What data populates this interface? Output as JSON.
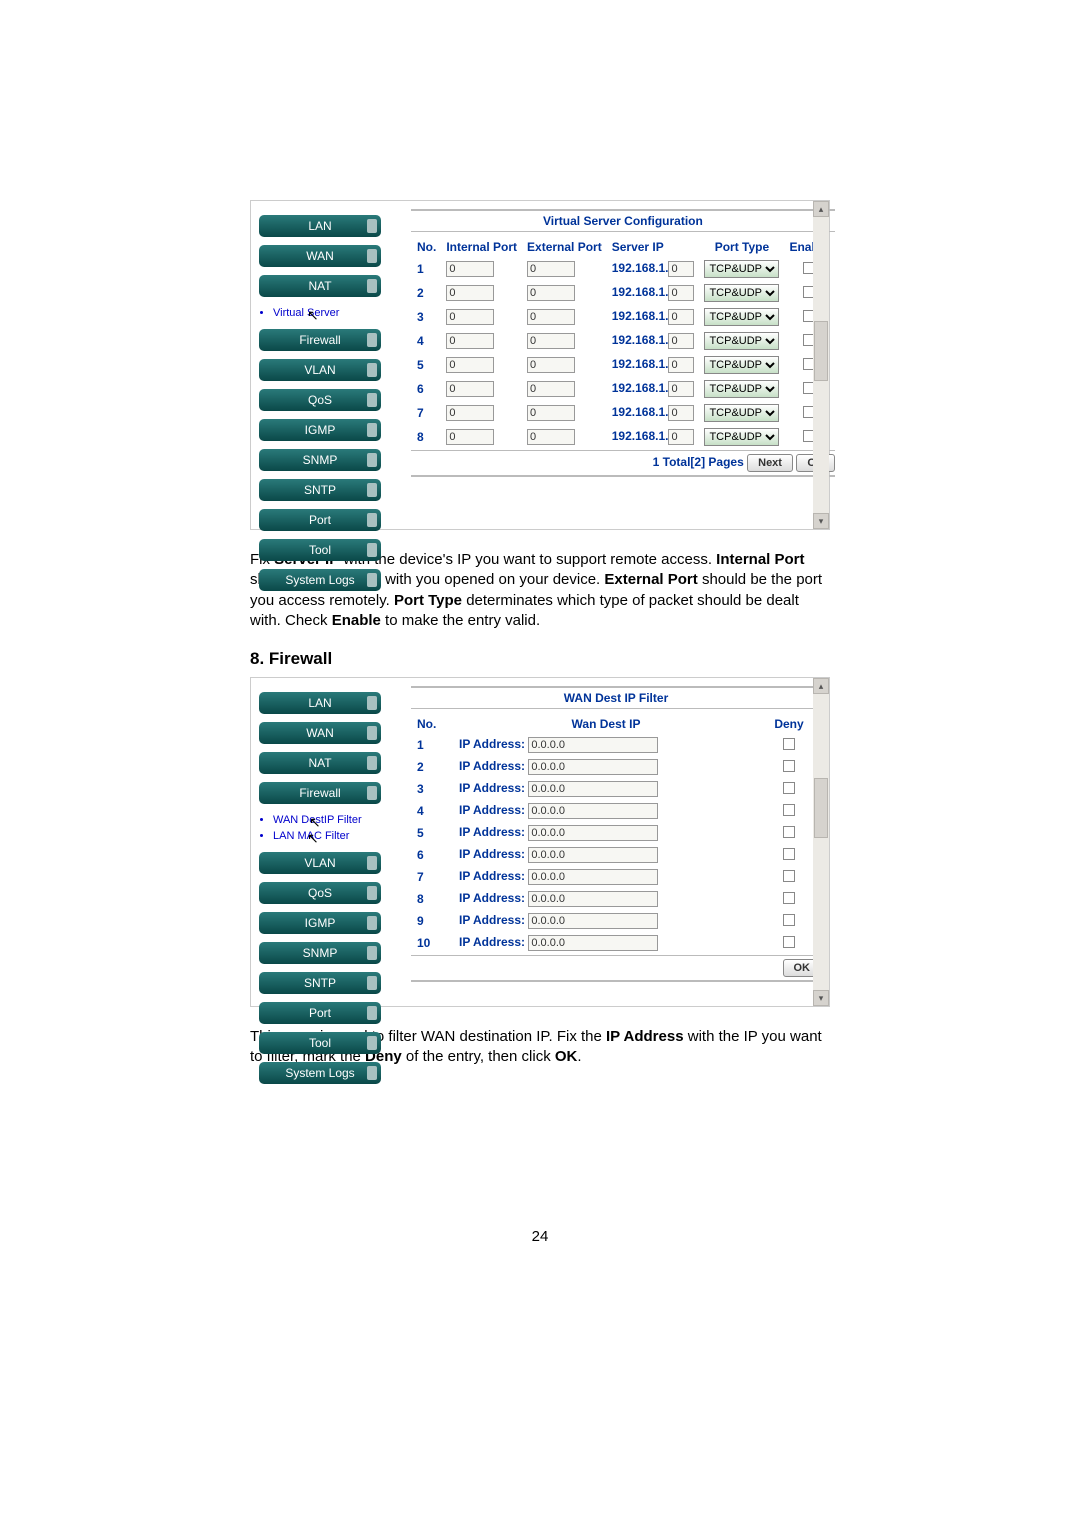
{
  "sidebar": {
    "lan": "LAN",
    "wan": "WAN",
    "nat": "NAT",
    "virtual_server": "Virtual Server",
    "firewall": "Firewall",
    "wan_dest_ip_filter": "WAN DestIP Filter",
    "lan_mac_filter": "LAN MAC Filter",
    "vlan": "VLAN",
    "qos": "QoS",
    "igmp": "IGMP",
    "snmp": "SNMP",
    "sntp": "SNTP",
    "port": "Port",
    "tool": "Tool",
    "system_logs": "System Logs"
  },
  "vs_panel": {
    "title": "Virtual Server Configuration",
    "headers": {
      "no": "No.",
      "internal": "Internal Port",
      "external": "External Port",
      "server_ip": "Server IP",
      "port_type": "Port Type",
      "enable": "Enable"
    },
    "rows": [
      {
        "no": "1",
        "internal": "0",
        "external": "0",
        "ip_prefix": "192.168.1.",
        "ip_last": "0",
        "type": "TCP&UDP"
      },
      {
        "no": "2",
        "internal": "0",
        "external": "0",
        "ip_prefix": "192.168.1.",
        "ip_last": "0",
        "type": "TCP&UDP"
      },
      {
        "no": "3",
        "internal": "0",
        "external": "0",
        "ip_prefix": "192.168.1.",
        "ip_last": "0",
        "type": "TCP&UDP"
      },
      {
        "no": "4",
        "internal": "0",
        "external": "0",
        "ip_prefix": "192.168.1.",
        "ip_last": "0",
        "type": "TCP&UDP"
      },
      {
        "no": "5",
        "internal": "0",
        "external": "0",
        "ip_prefix": "192.168.1.",
        "ip_last": "0",
        "type": "TCP&UDP"
      },
      {
        "no": "6",
        "internal": "0",
        "external": "0",
        "ip_prefix": "192.168.1.",
        "ip_last": "0",
        "type": "TCP&UDP"
      },
      {
        "no": "7",
        "internal": "0",
        "external": "0",
        "ip_prefix": "192.168.1.",
        "ip_last": "0",
        "type": "TCP&UDP"
      },
      {
        "no": "8",
        "internal": "0",
        "external": "0",
        "ip_prefix": "192.168.1.",
        "ip_last": "0",
        "type": "TCP&UDP"
      }
    ],
    "footer_text": "1 Total[2] Pages",
    "next": "Next",
    "ok": "OK"
  },
  "desc1": {
    "p1a": "Fix ",
    "p1b": "Server IP",
    "p1c": " with the device's IP you want to support remote access. ",
    "p1d": "Internal Port",
    "p1e": " should be the same with you opened on your device. ",
    "p1f": "External Port",
    "p1g": " should be the port you access remotely. ",
    "p1h": "Port Type",
    "p1i": " determinates which type of packet should be dealt with. Check ",
    "p1j": "Enable",
    "p1k": " to make the entry valid."
  },
  "section8": "8. Firewall",
  "ip_panel": {
    "title": "WAN Dest IP Filter",
    "headers": {
      "no": "No.",
      "wan_dest_ip": "Wan Dest IP",
      "deny": "Deny"
    },
    "label": "IP Address:",
    "value": "0.0.0.0",
    "rows": [
      "1",
      "2",
      "3",
      "4",
      "5",
      "6",
      "7",
      "8",
      "9",
      "10"
    ],
    "ok": "OK"
  },
  "desc2": {
    "a": "This page is used to filter WAN destination IP. Fix the ",
    "b": "IP Address",
    "c": " with the IP you want to filter, mark the ",
    "d": "Deny",
    "e": " of the entry, then click ",
    "f": "OK",
    "g": "."
  },
  "page_number": "24"
}
